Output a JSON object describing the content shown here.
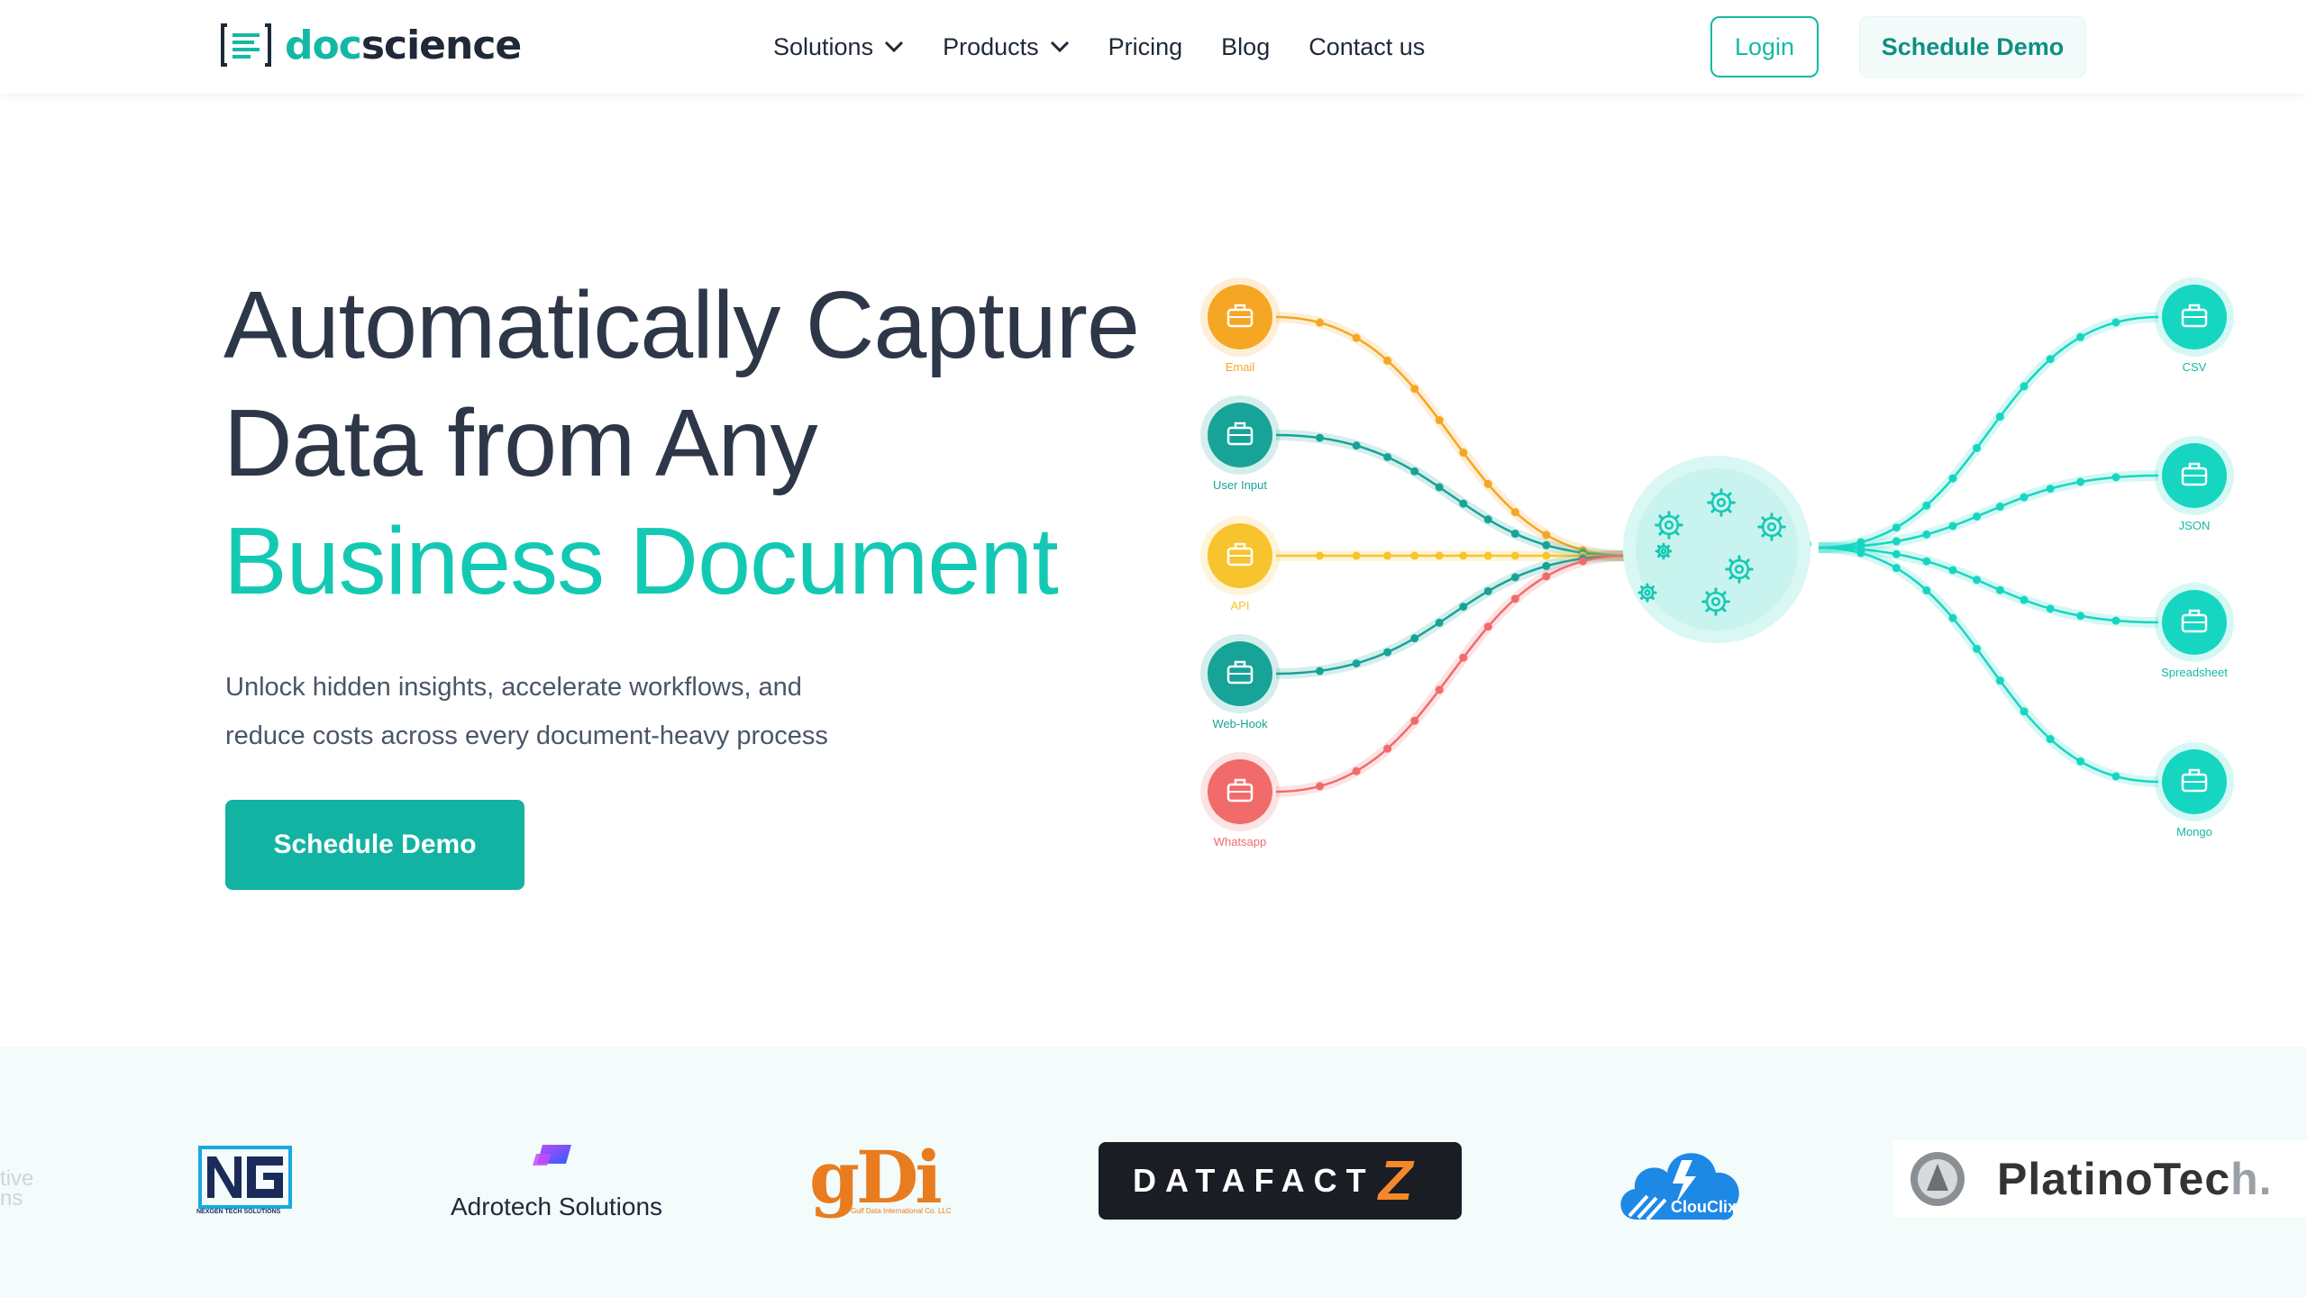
{
  "brand": {
    "part1": "doc",
    "part2": "science"
  },
  "nav": {
    "items": [
      {
        "label": "Solutions",
        "has_dropdown": true
      },
      {
        "label": "Products",
        "has_dropdown": true
      },
      {
        "label": "Pricing",
        "has_dropdown": false
      },
      {
        "label": "Blog",
        "has_dropdown": false
      },
      {
        "label": "Contact us",
        "has_dropdown": false
      }
    ],
    "login_label": "Login",
    "demo_label": "Schedule Demo"
  },
  "hero": {
    "title_line1": "Automatically Capture",
    "title_line2": "Data from Any",
    "title_line3": "Business Document",
    "subtitle_line1": "Unlock hidden insights, accelerate workflows, and",
    "subtitle_line2": "reduce costs across every document-heavy process",
    "cta_label": "Schedule Demo"
  },
  "diagram": {
    "inputs": [
      {
        "label": "Email",
        "color": "#f5a623"
      },
      {
        "label": "User Input",
        "color": "#17a398"
      },
      {
        "label": "API",
        "color": "#f7c42d"
      },
      {
        "label": "Web-Hook",
        "color": "#17a398"
      },
      {
        "label": "Whatsapp",
        "color": "#f16b6b"
      }
    ],
    "outputs": [
      {
        "label": "CSV",
        "color": "#16d6c2"
      },
      {
        "label": "JSON",
        "color": "#16d6c2"
      },
      {
        "label": "Spreadsheet",
        "color": "#16d6c2"
      },
      {
        "label": "Mongo",
        "color": "#16d6c2"
      }
    ],
    "core_icon": "gears-icon"
  },
  "logos": {
    "faded_partial_line1": "tive",
    "faded_partial_line2": "ns",
    "ng_caption": "NEXGEN TECH SOLUTIONS",
    "adrotech": "Adrotech Solutions",
    "gdi": "gDi",
    "gdi_caption": "Gulf Data International Co. LLC",
    "datafactz_main": "DATAFACT",
    "datafactz_z": "Z",
    "clouclix": "ClouClix",
    "platino_main": "PlatinoTec",
    "platino_tail": "h."
  },
  "colors": {
    "accent": "#14c9b4",
    "primary_button": "#12b3a2",
    "heading": "#2d3748"
  }
}
